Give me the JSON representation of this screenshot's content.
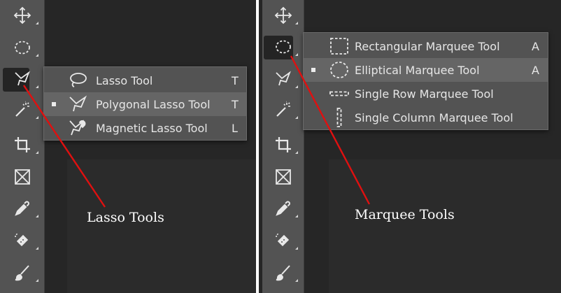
{
  "left_panel": {
    "toolbar": [
      {
        "icon": "move-icon"
      },
      {
        "icon": "elliptical-marquee-icon"
      },
      {
        "icon": "polygonal-lasso-icon",
        "active": true
      },
      {
        "icon": "magic-wand-icon"
      },
      {
        "icon": "crop-icon"
      },
      {
        "icon": "frame-icon"
      },
      {
        "icon": "eyedropper-icon"
      },
      {
        "icon": "spot-healing-icon"
      },
      {
        "icon": "brush-icon"
      }
    ],
    "flyout": {
      "items": [
        {
          "icon": "lasso-icon",
          "label": "Lasso Tool",
          "key": "T",
          "selected": false
        },
        {
          "icon": "polygonal-lasso-icon",
          "label": "Polygonal Lasso Tool",
          "key": "T",
          "selected": true
        },
        {
          "icon": "magnetic-lasso-icon",
          "label": "Magnetic Lasso Tool",
          "key": "L",
          "selected": false
        }
      ]
    },
    "annotation": "Lasso Tools"
  },
  "right_panel": {
    "toolbar": [
      {
        "icon": "move-icon"
      },
      {
        "icon": "elliptical-marquee-icon",
        "active": true
      },
      {
        "icon": "polygonal-lasso-icon"
      },
      {
        "icon": "magic-wand-icon"
      },
      {
        "icon": "crop-icon"
      },
      {
        "icon": "frame-icon"
      },
      {
        "icon": "eyedropper-icon"
      },
      {
        "icon": "spot-healing-icon"
      },
      {
        "icon": "brush-icon"
      }
    ],
    "flyout": {
      "items": [
        {
          "icon": "rectangular-marquee-icon",
          "label": "Rectangular Marquee Tool",
          "key": "A",
          "selected": false
        },
        {
          "icon": "elliptical-marquee-icon",
          "label": "Elliptical Marquee Tool",
          "key": "A",
          "selected": true
        },
        {
          "icon": "single-row-marquee-icon",
          "label": "Single Row Marquee Tool",
          "key": "",
          "selected": false
        },
        {
          "icon": "single-column-marquee-icon",
          "label": "Single Column Marquee Tool",
          "key": "",
          "selected": false
        }
      ]
    },
    "annotation": "Marquee Tools"
  },
  "colors": {
    "toolbar": "#535353",
    "flyout": "#535353",
    "flyout_selected": "#656565",
    "canvas": "#262626",
    "pointer_line": "#e01010",
    "icon": "#e8e8e8"
  }
}
